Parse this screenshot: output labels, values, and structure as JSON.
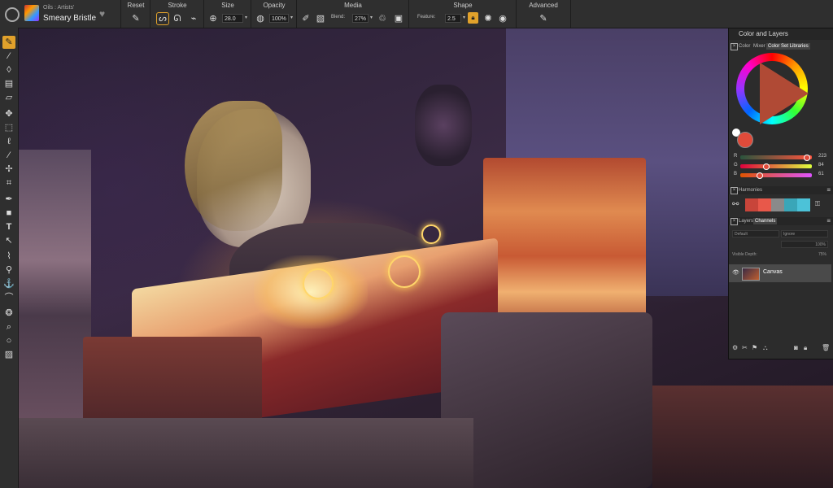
{
  "brush": {
    "category": "Oils : Artists'",
    "name": "Smeary Bristle"
  },
  "toolbar": {
    "groups": {
      "reset": "Reset",
      "stroke": "Stroke",
      "size": "Size",
      "opacity": "Opacity",
      "media": "Media",
      "shape": "Shape",
      "advanced": "Advanced"
    },
    "size_value": "28.0",
    "opacity_value": "100%",
    "blend_label": "Blend:",
    "blend_value": "27%",
    "feature_label": "Feature:",
    "feature_value": "2.5"
  },
  "panel": {
    "title": "Color and Layers",
    "color_tabs": [
      "Color",
      "Mixer",
      "Color Set Libraries"
    ],
    "rgb": {
      "r_label": "R",
      "r_value": "223",
      "g_label": "G",
      "g_value": "84",
      "b_label": "B",
      "b_value": "61"
    },
    "harmonies_label": "Harmonies",
    "layer_tabs": [
      "Layers",
      "Channels"
    ],
    "composite_method": "Default",
    "composite_depth": "Ignore",
    "opacity_value": "100%",
    "visible_depth_label": "Visible Depth:",
    "visible_depth_value": "75%",
    "layer_name": "Canvas"
  },
  "colors": {
    "accent": "#e1a22b",
    "current_color": "#df543d",
    "harmony_swatches": [
      "#c8453a",
      "#e8584a",
      "#8a8a8a",
      "#3aa6b8",
      "#4cc2d8"
    ]
  },
  "left_tools": [
    "brush-icon",
    "dropper-icon",
    "bucket-icon",
    "gradient-icon",
    "eraser-icon",
    "layer-adjuster-icon",
    "rect-select-icon",
    "lasso-icon",
    "magic-wand-icon",
    "transform-icon",
    "crop-icon",
    "pen-icon",
    "shape-icon",
    "text-icon",
    "path-select-icon",
    "cloner-icon",
    "rubber-stamp-icon",
    "dodge-icon",
    "burn-icon",
    "mirror-icon",
    "kaleidoscope-icon",
    "magnifier-icon",
    "rotate-icon",
    "navigator-icon"
  ]
}
